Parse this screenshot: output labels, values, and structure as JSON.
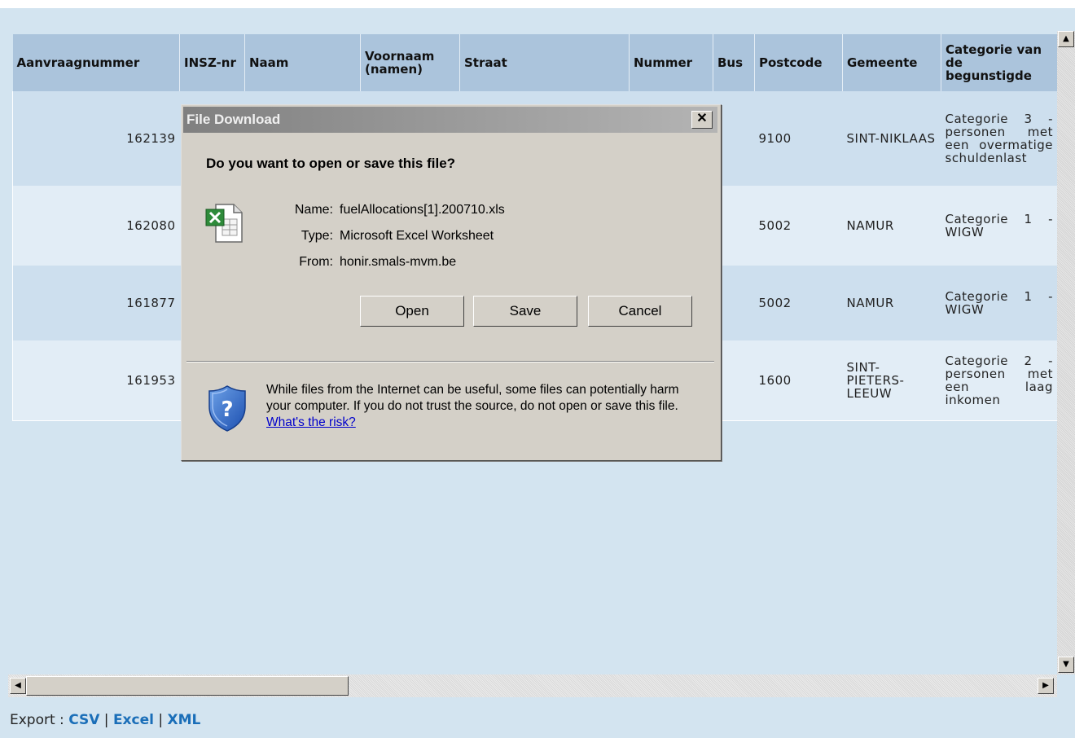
{
  "table": {
    "headers": [
      "Aanvraagnummer",
      "INSZ-nr",
      "Naam",
      "Voornaam (namen)",
      "Straat",
      "Nummer",
      "Bus",
      "Postcode",
      "Gemeente",
      "Categorie van de begunstigde"
    ],
    "rows": [
      {
        "aanvraagnummer": "162139",
        "postcode": "9100",
        "gemeente": "SINT-NIKLAAS",
        "categorie": "Categorie 3 - personen met een overmatige schuldenlast"
      },
      {
        "aanvraagnummer": "162080",
        "postcode": "5002",
        "gemeente": "NAMUR",
        "categorie": "Categorie 1 - WIGW"
      },
      {
        "aanvraagnummer": "161877",
        "postcode": "5002",
        "gemeente": "NAMUR",
        "categorie": "Categorie 1 - WIGW"
      },
      {
        "aanvraagnummer": "161953",
        "postcode": "1600",
        "gemeente": "SINT-PIETERS-LEEUW",
        "categorie": "Categorie 2 - personen met een laag inkomen"
      }
    ]
  },
  "export": {
    "label": "Export :",
    "csv": "CSV",
    "excel": "Excel",
    "xml": "XML",
    "sep": "|"
  },
  "dialog": {
    "title": "File Download",
    "question": "Do you want to open or save this file?",
    "name_label": "Name:",
    "name_value": "fuelAllocations[1].200710.xls",
    "type_label": "Type:",
    "type_value": "Microsoft Excel Worksheet",
    "from_label": "From:",
    "from_value": "honir.smals-mvm.be",
    "open": "Open",
    "save": "Save",
    "cancel": "Cancel",
    "warning": "While files from the Internet can be useful, some files can potentially harm your computer. If you do not trust the source, do not open or save this file.",
    "risk_link": "What's the risk?"
  },
  "icons": {
    "close": "close-icon",
    "file": "excel-file-icon",
    "shield": "security-shield-icon"
  },
  "colors": {
    "background": "#d3e4f0",
    "header": "#abc4dc",
    "link": "#1a6eb8",
    "dialog": "#d4d0c8"
  }
}
